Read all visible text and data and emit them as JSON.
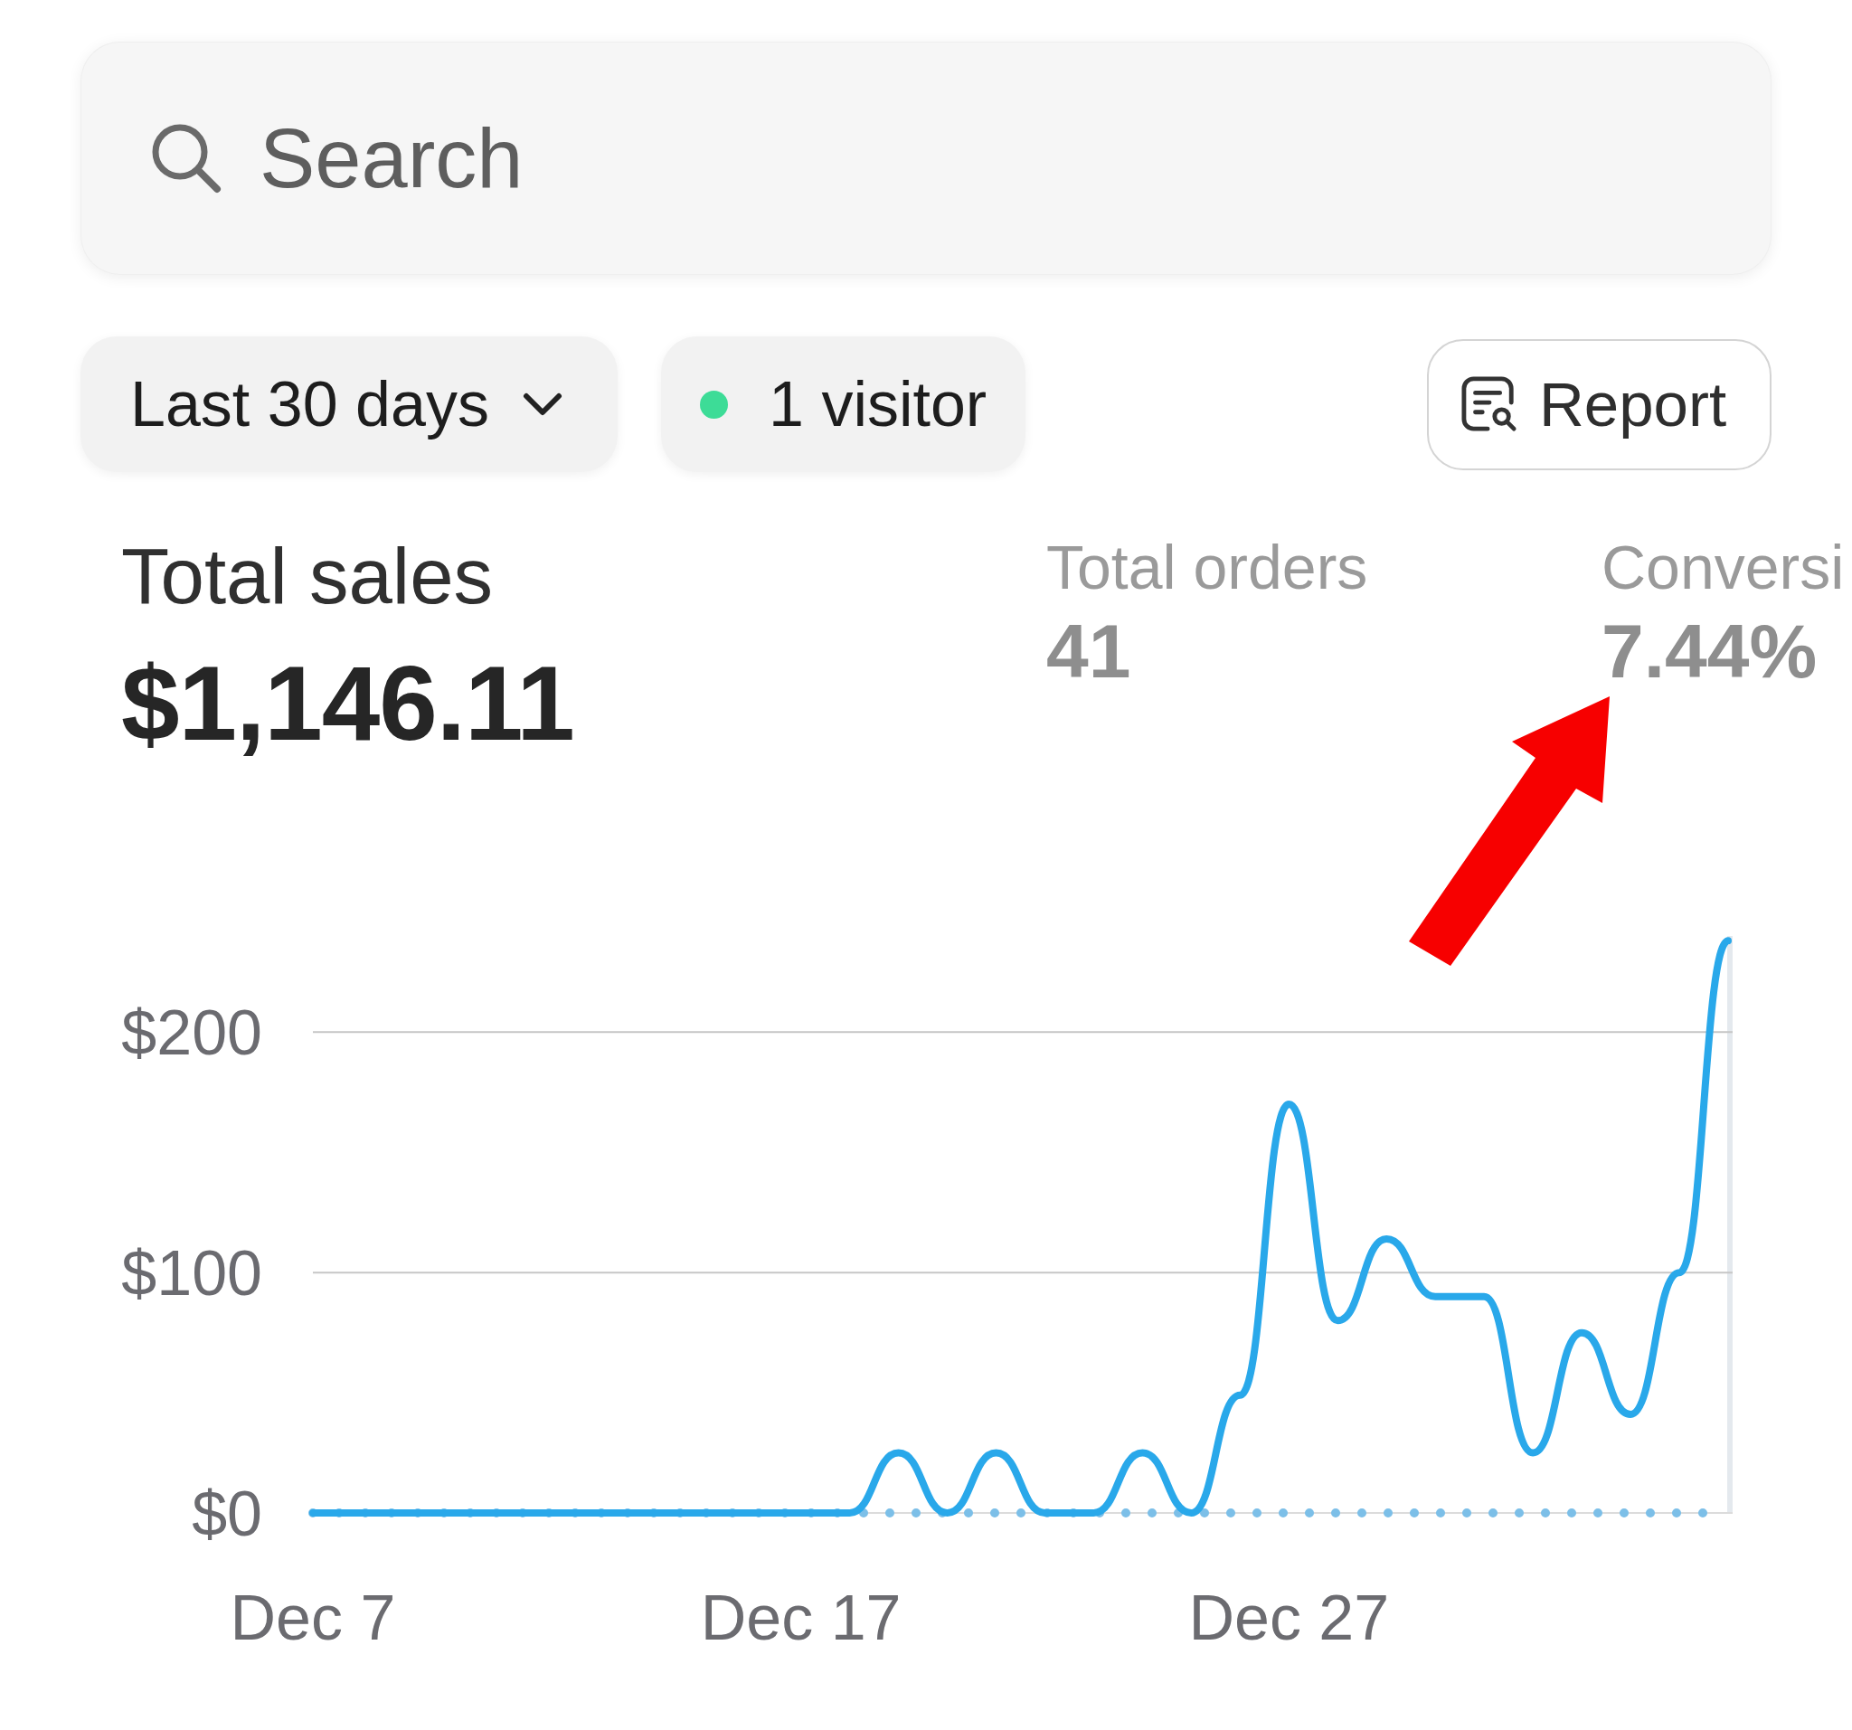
{
  "search": {
    "placeholder": "Search"
  },
  "filters": {
    "date_range": {
      "label": "Last 30 days"
    },
    "visitors": {
      "label": "1 visitor",
      "live": true
    },
    "report": {
      "label": "Report"
    }
  },
  "metrics": [
    {
      "kind": "primary",
      "label": "Total sales",
      "value": "$1,146.11"
    },
    {
      "kind": "secondary",
      "label": "Total orders",
      "value": "41"
    },
    {
      "kind": "secondary",
      "label": "Conversi",
      "value": "7.44%"
    }
  ],
  "annotations": [
    {
      "kind": "arrow"
    }
  ],
  "chart": {
    "chart_data": {
      "type": "line",
      "categories": [
        "Dec 7",
        null,
        null,
        null,
        null,
        null,
        null,
        null,
        null,
        null,
        "Dec 17",
        null,
        null,
        null,
        null,
        null,
        null,
        null,
        null,
        null,
        "Dec 27",
        null,
        null,
        null,
        null,
        null,
        null,
        null,
        null,
        null
      ],
      "ylim": [
        0,
        240
      ],
      "yticks": [
        {
          "value": 0,
          "label": "$0"
        },
        {
          "value": 100,
          "label": "$100"
        },
        {
          "value": 200,
          "label": "$200"
        }
      ],
      "series": [
        {
          "color": "#29a8ea",
          "values": [
            0,
            0,
            0,
            0,
            0,
            0,
            0,
            0,
            0,
            0,
            0,
            0,
            25,
            0,
            25,
            0,
            0,
            25,
            0,
            49,
            170,
            80,
            114,
            90,
            90,
            25,
            75,
            41,
            100,
            238
          ]
        }
      ]
    }
  }
}
